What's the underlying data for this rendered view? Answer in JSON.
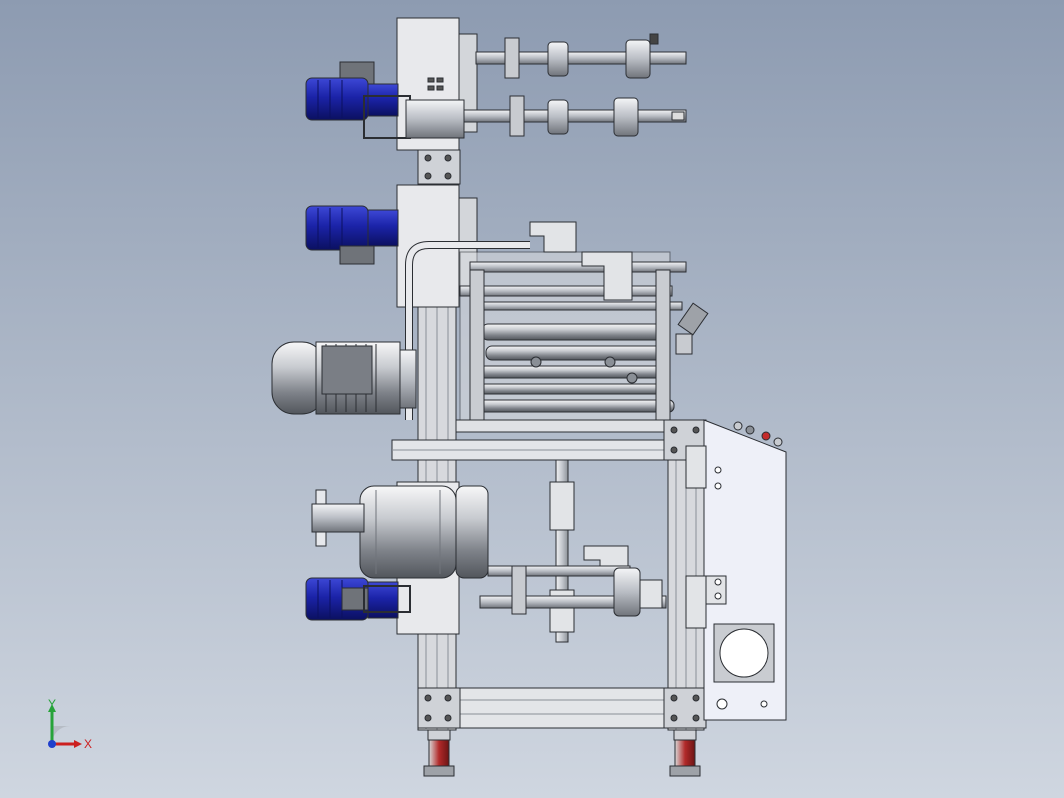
{
  "viewport": {
    "background_top": "#8d9bb1",
    "background_bottom": "#cfd6e0"
  },
  "triad": {
    "x_label": "X",
    "y_label": "Y",
    "x_color": "#cc1f1f",
    "y_color": "#27a33a",
    "z_color": "#1f3fcc"
  },
  "colors": {
    "motor_blue": "#1b23a8",
    "steel_light": "#e6e8ec",
    "steel_mid": "#b9bdc4",
    "steel_dark": "#7d828a",
    "panel": "#eef0f8",
    "outline": "#2b2e33",
    "foot_red": "#b22a2a"
  }
}
